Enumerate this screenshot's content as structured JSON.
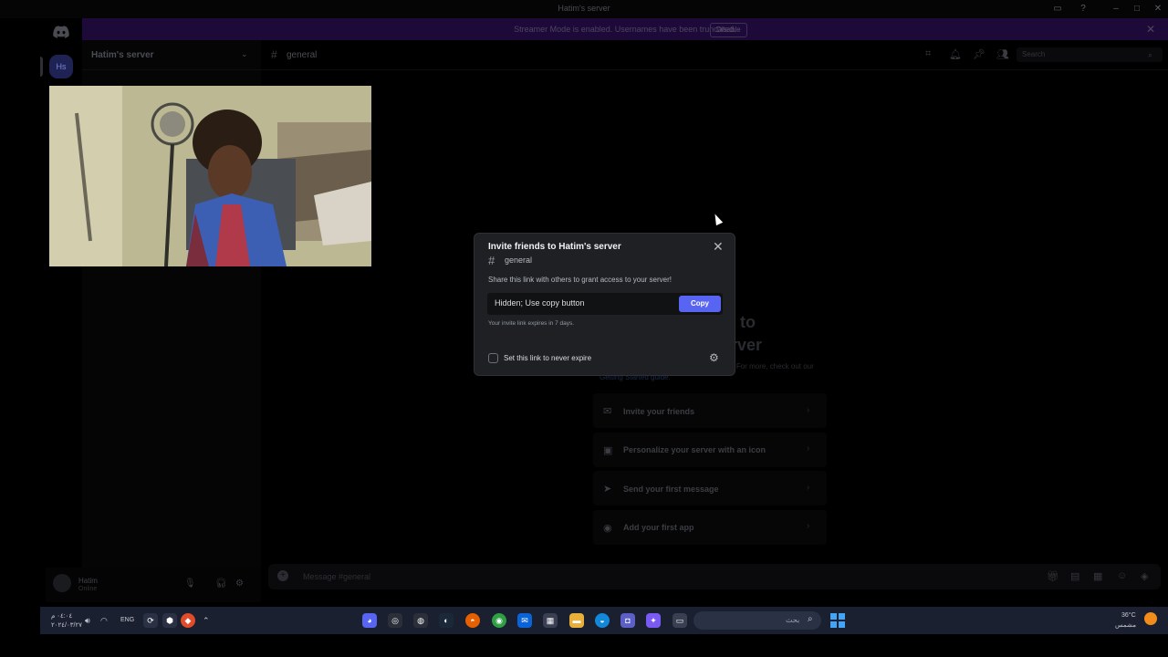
{
  "window": {
    "title": "Hatim's server"
  },
  "banner": {
    "message": "Streamer Mode is enabled. Usernames have been truncated.",
    "disable_label": "Disable"
  },
  "server": {
    "icon_text": "Hs",
    "name": "Hatim's server"
  },
  "channel": {
    "name": "general"
  },
  "header": {
    "search_placeholder": "Search"
  },
  "user": {
    "name": "Hatim",
    "status": "Online"
  },
  "welcome": {
    "title_line1": "to",
    "title_line2": "rver",
    "subtitle": "re are some steps to help you get started. For more, check out our",
    "link": "Getting Started guide."
  },
  "steps": [
    {
      "label": "Invite your friends",
      "icon": "invite-icon"
    },
    {
      "label": "Personalize your server with an icon",
      "icon": "personalize-icon"
    },
    {
      "label": "Send your first message",
      "icon": "send-icon"
    },
    {
      "label": "Add your first app",
      "icon": "gamepad-icon"
    }
  ],
  "composer": {
    "placeholder": "Message #general"
  },
  "modal": {
    "title": "Invite friends to Hatim's server",
    "channel": "general",
    "description": "Share this link with others to grant access to your server!",
    "link_value": "Hidden; Use copy button",
    "copy_label": "Copy",
    "expire_note": "Your invite link expires in 7 days.",
    "never_expire_label": "Set this link to never expire",
    "never_expire_checked": false
  },
  "taskbar": {
    "time": "٠٤:٠٤ م",
    "date": "٢٠٢٤/٠٣/٢٧",
    "language": "ENG",
    "search_placeholder": "بحث",
    "weather_temp": "36°C",
    "weather_desc": "مشمس"
  },
  "colors": {
    "blurple": "#5865f2",
    "modal_bg": "#1f2024",
    "banner": "#1e0a38"
  }
}
